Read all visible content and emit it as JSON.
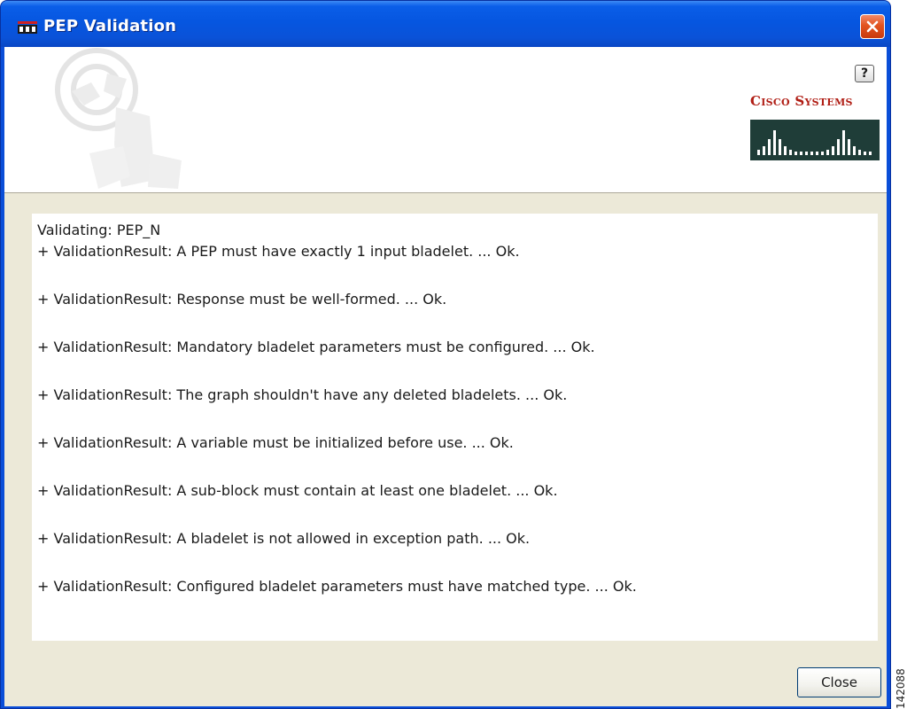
{
  "window": {
    "title": "PEP Validation",
    "close_glyph": "✕"
  },
  "banner": {
    "help_label": "?",
    "logo_text": "Cisco Systems",
    "logo_color": "#b01d14"
  },
  "log": {
    "heading": "Validating: PEP_N",
    "lines": [
      "+ ValidationResult: A PEP must have exactly 1 input bladelet. ... Ok.",
      "+ ValidationResult: Response must be well-formed. ... Ok.",
      "+ ValidationResult: Mandatory bladelet parameters must be configured. ... Ok.",
      "+ ValidationResult: The graph shouldn't have any deleted bladelets. ... Ok.",
      "+ ValidationResult: A variable must be initialized before use. ... Ok.",
      "+ ValidationResult: A sub-block must contain at least one bladelet. ... Ok.",
      "+ ValidationResult: A bladelet is not allowed in exception path. ... Ok.",
      "+ ValidationResult: Configured bladelet parameters must have matched type. ... Ok."
    ]
  },
  "footer": {
    "close_label": "Close"
  },
  "side_mark": "142088",
  "colors": {
    "titlebar": "#0a52d8",
    "close_button": "#e2531f",
    "dialog_background": "#ece9d8"
  }
}
